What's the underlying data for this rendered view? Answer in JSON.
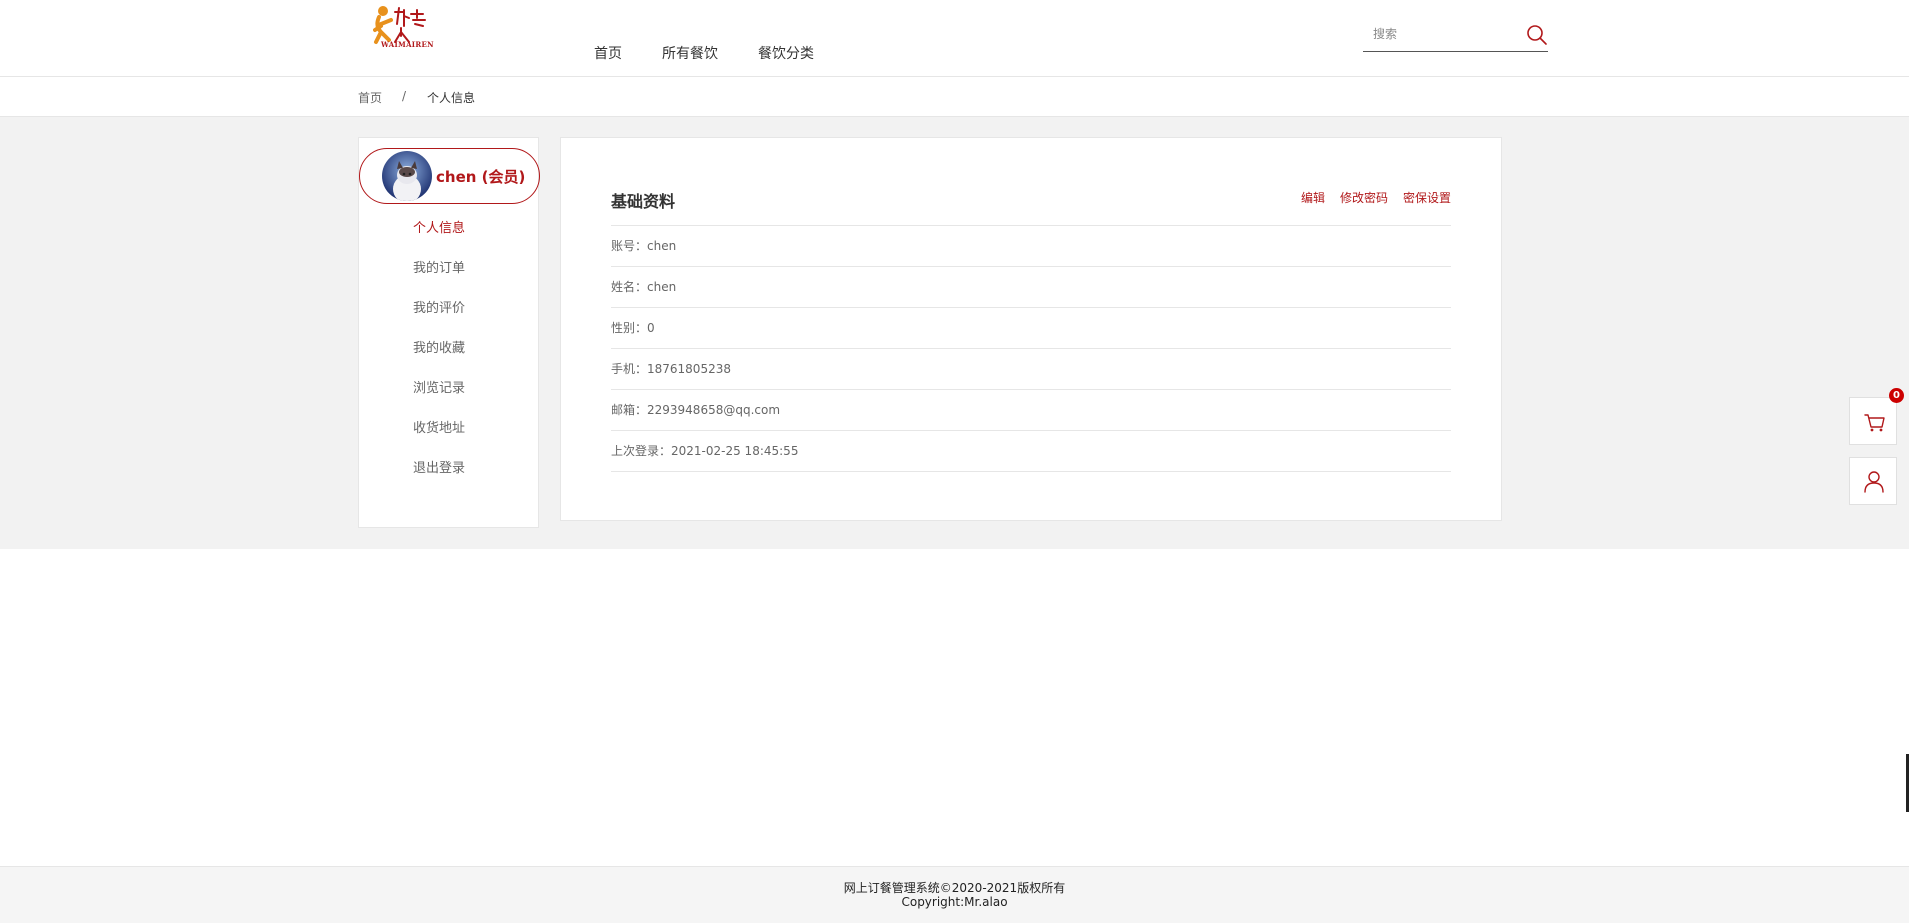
{
  "header": {
    "logo_text": "WAIMAIREN",
    "nav": [
      "首页",
      "所有餐饮",
      "餐饮分类"
    ],
    "search": {
      "placeholder": "搜索",
      "value": ""
    }
  },
  "breadcrumb": {
    "home": "首页",
    "separator": "/",
    "current": "个人信息"
  },
  "sidebar": {
    "user_name": "chen (会员)",
    "menu": [
      "个人信息",
      "我的订单",
      "我的评价",
      "我的收藏",
      "浏览记录",
      "收货地址",
      "退出登录"
    ],
    "active_index": 0
  },
  "profile": {
    "title": "基础资料",
    "actions": [
      "编辑",
      "修改密码",
      "密保设置"
    ],
    "rows": [
      "账号：chen",
      "姓名：chen",
      "性别：0",
      "手机：18761805238",
      "邮箱：2293948658@qq.com",
      "上次登录：2021-02-25 18:45:55"
    ]
  },
  "float": {
    "cart_count": "0"
  },
  "footer": {
    "line1": "网上订餐管理系统©2020-2021版权所有",
    "line2": "Copyright:Mr.alao"
  },
  "colors": {
    "accent": "#b1181a",
    "background": "#f2f2f2",
    "logo_orange": "#e8911c"
  }
}
